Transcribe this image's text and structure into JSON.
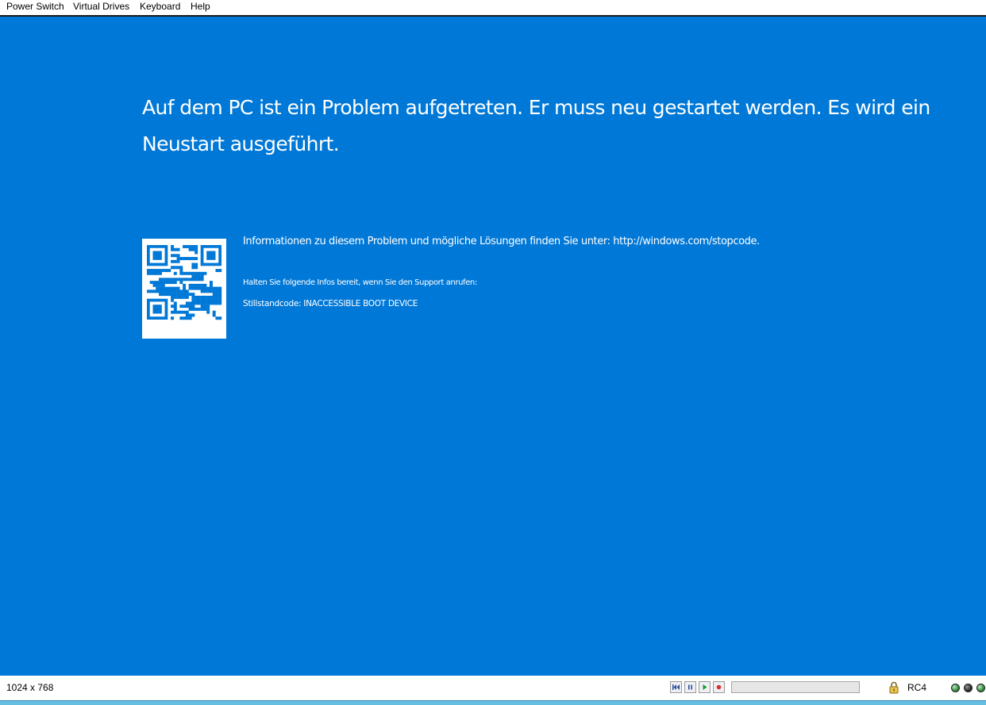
{
  "menu": {
    "items": [
      "Power Switch",
      "Virtual Drives",
      "Keyboard",
      "Help"
    ]
  },
  "screen": {
    "background_color": "#0078d7",
    "headline": "Auf dem PC ist ein Problem aufgetreten. Er muss neu gestartet werden. Es wird ein Neustart ausgeführt.",
    "info_text": "Informationen zu diesem Problem und mögliche Lösungen finden Sie unter: http://windows.com/stopcode.",
    "support_text": "Halten Sie folgende Infos bereit, wenn Sie den Support anrufen:",
    "stop_code_text": "Stillstandcode: INACCESSIBLE BOOT DEVICE"
  },
  "statusbar": {
    "resolution": "1024 x 768",
    "controls": [
      "skip-back-icon",
      "pause-icon",
      "play-icon",
      "record-icon"
    ],
    "progress": 0,
    "lock_icon": "lock-icon",
    "encryption": "RC4",
    "indicators": [
      {
        "name": "indicator-led-1",
        "color": "#2e8b3a"
      },
      {
        "name": "indicator-led-2",
        "color": "#3b3b3b"
      },
      {
        "name": "indicator-led-3",
        "color": "#2e8b3a"
      }
    ]
  }
}
